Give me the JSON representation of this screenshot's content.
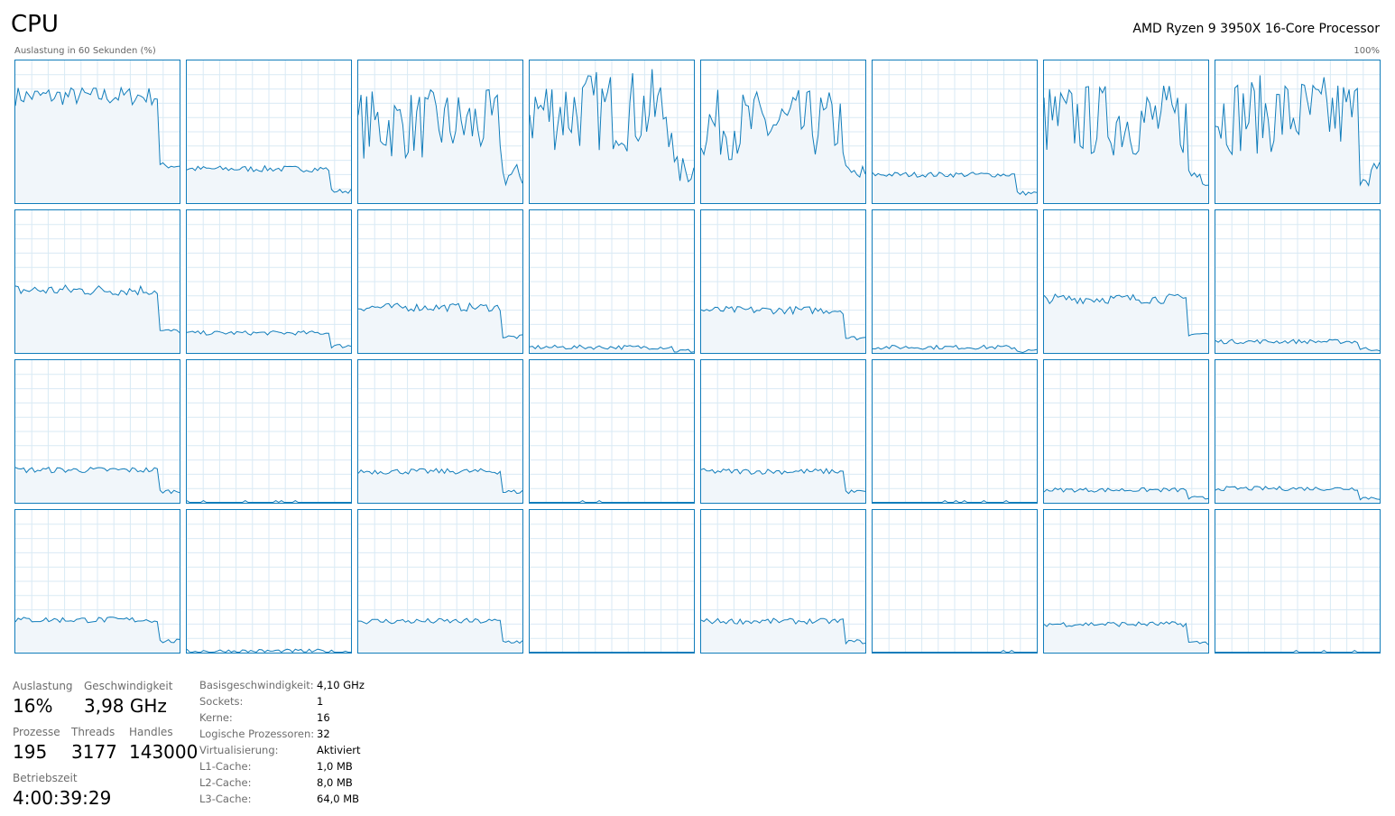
{
  "header": {
    "title": "CPU",
    "processor": "AMD Ryzen 9 3950X 16-Core Processor",
    "y_label": "Auslastung in 60 Sekunden (%)",
    "y_max": "100%"
  },
  "colors": {
    "line": "#117dbb",
    "fill": "#f1f6fa",
    "grid": "#d9eaf4",
    "border": "#117dbb"
  },
  "graphs": {
    "rows": 4,
    "cols": 8,
    "levels_percent": [
      [
        75,
        24,
        55,
        65,
        55,
        20,
        58,
        62
      ],
      [
        44,
        14,
        32,
        4,
        30,
        4,
        38,
        8
      ],
      [
        23,
        0,
        22,
        0,
        22,
        0,
        9,
        10
      ],
      [
        23,
        1,
        22,
        0,
        22,
        0,
        20,
        0
      ]
    ]
  },
  "stats": {
    "auslastung_label": "Auslastung",
    "auslastung_value": "16%",
    "geschwindigkeit_label": "Geschwindigkeit",
    "geschwindigkeit_value": "3,98 GHz",
    "prozesse_label": "Prozesse",
    "prozesse_value": "195",
    "threads_label": "Threads",
    "threads_value": "3177",
    "handles_label": "Handles",
    "handles_value": "143000",
    "betriebszeit_label": "Betriebszeit",
    "betriebszeit_value": "4:00:39:29"
  },
  "info": [
    {
      "key": "Basisgeschwindigkeit:",
      "value": "4,10 GHz"
    },
    {
      "key": "Sockets:",
      "value": "1"
    },
    {
      "key": "Kerne:",
      "value": "16"
    },
    {
      "key": "Logische Prozessoren:",
      "value": "32"
    },
    {
      "key": "Virtualisierung:",
      "value": "Aktiviert"
    },
    {
      "key": "L1-Cache:",
      "value": "1,0 MB"
    },
    {
      "key": "L2-Cache:",
      "value": "8,0 MB"
    },
    {
      "key": "L3-Cache:",
      "value": "64,0 MB"
    }
  ]
}
